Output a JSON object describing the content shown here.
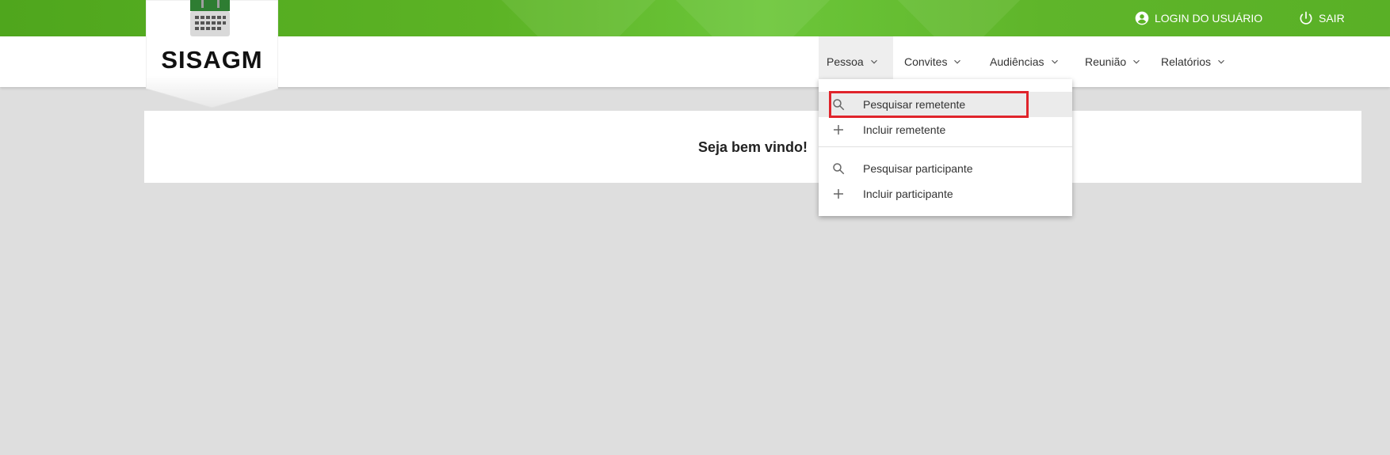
{
  "app": {
    "logo_text": "SISAGM"
  },
  "topbar": {
    "login_label": "LOGIN DO USUÁRIO",
    "logout_label": "SAIR",
    "login_icon": "account-circle-icon",
    "logout_icon": "power-icon"
  },
  "nav": {
    "items": [
      {
        "label": "Pessoa",
        "active": true
      },
      {
        "label": "Convites"
      },
      {
        "label": "Audiências"
      },
      {
        "label": "Reunião"
      },
      {
        "label": "Relatórios"
      }
    ]
  },
  "dropdown": {
    "items": [
      {
        "label": "Pesquisar remetente",
        "icon": "search-icon",
        "hovered": true
      },
      {
        "label": "Incluir remetente",
        "icon": "plus-icon"
      },
      {
        "label": "Pesquisar participante",
        "icon": "search-icon"
      },
      {
        "label": "Incluir participante",
        "icon": "plus-icon"
      }
    ]
  },
  "main": {
    "welcome_text": "Seja bem vindo!"
  },
  "colors": {
    "topbar_green": "#5cb325",
    "highlight_red": "#e0242b",
    "calendar_green": "#2e7d32",
    "background": "#dedede"
  }
}
